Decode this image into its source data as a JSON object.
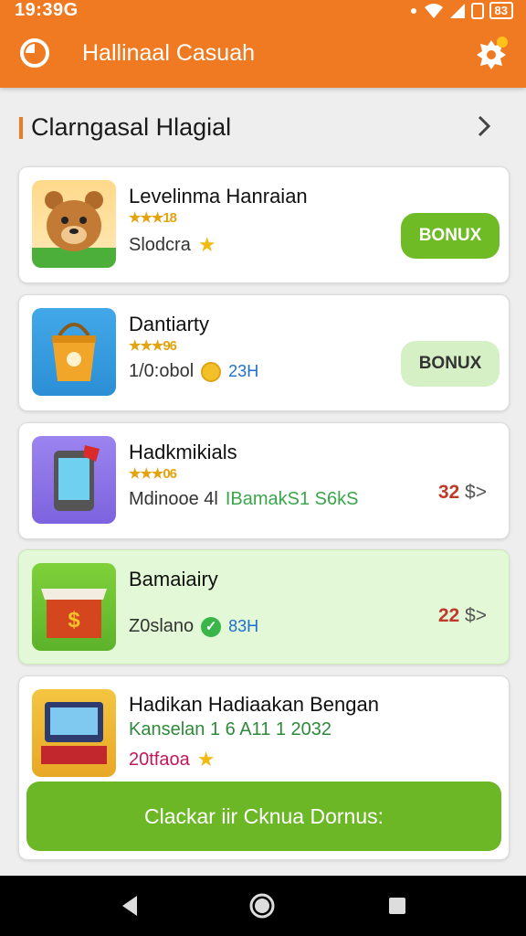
{
  "status": {
    "time": "19:39G",
    "battery": "83"
  },
  "appbar": {
    "title": "Hallinaal Casuah"
  },
  "section": {
    "title": "Clarngasal Hlagial"
  },
  "games": [
    {
      "title": "Levelinma Hanraian",
      "stars": "★★★18",
      "meta": "Slodcra",
      "action": "BONUX",
      "action_style": "solid"
    },
    {
      "title": "Dantiarty",
      "stars": "★★★96",
      "meta": "1/0:obol",
      "extra": "23H",
      "action": "BONUX",
      "action_style": "light"
    },
    {
      "title": "Hadkmikials",
      "stars": "★★★06",
      "meta": "Mdinooe 4l",
      "meta_green": "IBamakS1 S6kS",
      "price": "32",
      "price_suffix": "$>"
    },
    {
      "title": "Bamaiairy",
      "meta": "Z0slano",
      "extra": "83H",
      "price": "22",
      "price_suffix": "$>"
    },
    {
      "title": "Hadikan Hadiaakan Bengan",
      "subtitle": "Kanselan 1 6 A11 1 2032",
      "meta": "20tfaoa",
      "cta": "Clackar iir Cknua Dornus:"
    }
  ],
  "colors": {
    "accent": "#f07a22",
    "green": "#6fbb25",
    "highlight": "#e3f8d6"
  },
  "icons": [
    "timer-icon",
    "settings-badge-icon",
    "chevron-right-icon",
    "star-icon",
    "coin-icon",
    "check-icon",
    "back-icon",
    "home-icon",
    "recents-icon"
  ]
}
